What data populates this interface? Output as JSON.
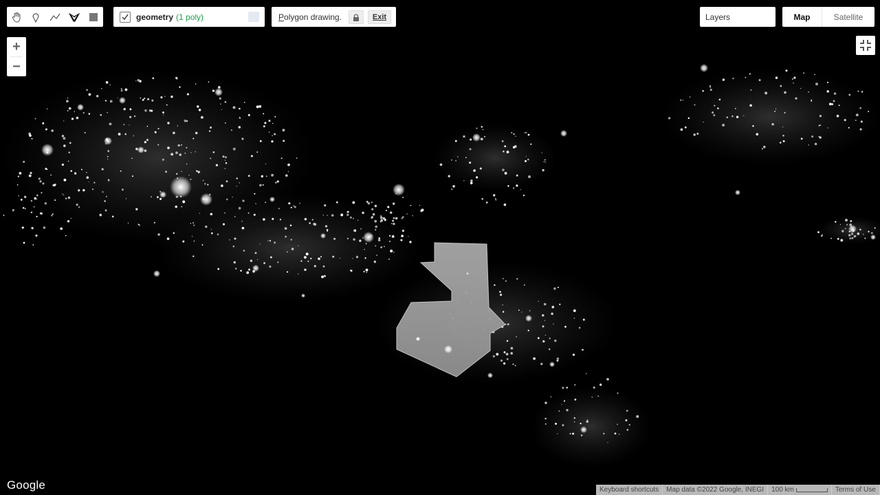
{
  "toolbar": {
    "tools": [
      {
        "name": "pan-hand-icon"
      },
      {
        "name": "point-marker-icon"
      },
      {
        "name": "line-icon"
      },
      {
        "name": "polygon-icon",
        "active": true
      },
      {
        "name": "rectangle-icon"
      }
    ]
  },
  "geometry": {
    "name": "geometry",
    "count": "(1 poly)"
  },
  "drawing": {
    "label_first": "P",
    "label_rest": "olygon drawing.",
    "exit_label": "Exit"
  },
  "layers": {
    "label": "Layers"
  },
  "maptype": {
    "map_label": "Map",
    "satellite_label": "Satellite"
  },
  "zoom": {
    "in_label": "+",
    "out_label": "−"
  },
  "brand": {
    "logo_text": "Google"
  },
  "footer": {
    "shortcuts": "Keyboard shortcuts",
    "map_data": "Map data ©2022 Google, INEGI",
    "scale": "100 km",
    "terms": "Terms of Use"
  },
  "colors": {
    "background": "#000000",
    "polygon_fill": "#9a9a9a",
    "city_lights": "#ffffff",
    "count_green": "#1aa34a"
  }
}
